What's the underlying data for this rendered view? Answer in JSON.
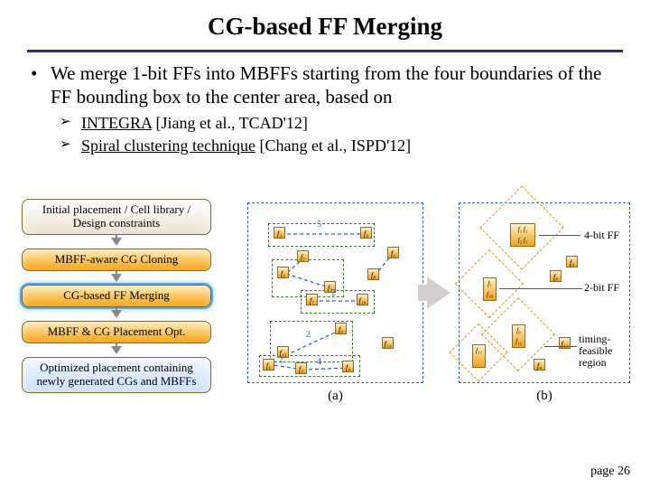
{
  "title": "CG-based FF Merging",
  "main_bullet": "We merge 1-bit FFs into MBFFs starting from the four boundaries of the FF bounding box to the center area, based on",
  "sub_bullets": [
    {
      "leadin": "INTEGRA",
      "rest": " [Jiang et al., TCAD'12]"
    },
    {
      "leadin": "Spiral clustering technique",
      "rest": " [Chang et al., ISPD'12]"
    }
  ],
  "flow": {
    "b1": "Initial placement / Cell library / Design constraints",
    "b2": "MBFF-aware CG Cloning",
    "b3": "CG-based FF Merging",
    "b4": "MBFF & CG Placement Opt.",
    "b5": "Optimized placement containing newly generated CGs and MBFFs"
  },
  "panels": {
    "a": "(a)",
    "b": "(b)"
  },
  "ff_labels": {
    "f1": "f₁",
    "f2": "f₂",
    "f3": "f₃",
    "f4": "f₄",
    "f5": "f₅",
    "f6": "f₆",
    "f7": "f₇",
    "f8": "f₈",
    "f9": "f₉",
    "f10": "f₁₀",
    "f11": "f₁₁",
    "f12": "f₁₂"
  },
  "edge_weights": {
    "e1": "5",
    "e2": "2",
    "e3": "2",
    "e4": "2",
    "e5": "4"
  },
  "legend": {
    "bit4": "4-bit FF",
    "bit2": "2-bit FF",
    "region": "timing-feasible region"
  },
  "page": "page 26",
  "chart_data": {
    "type": "diagram",
    "flow_steps": [
      "Initial placement / Cell library / Design constraints",
      "MBFF-aware CG Cloning",
      "CG-based FF Merging",
      "MBFF & CG Placement Opt.",
      "Optimized placement containing newly generated CGs and MBFFs"
    ],
    "highlighted_step_index": 2,
    "panel_a": {
      "nodes": [
        "f1",
        "f2",
        "f3",
        "f4",
        "f5",
        "f6",
        "f7",
        "f8",
        "f9",
        "f10",
        "f11",
        "f12"
      ],
      "edges": [
        {
          "u": "f2",
          "v": "f5",
          "w": 5
        },
        {
          "u": "f7",
          "v": "f10",
          "w": 2
        },
        {
          "u": "f9",
          "v": "f12",
          "w": 2
        },
        {
          "u": "f1",
          "v": "f3",
          "w": 2
        },
        {
          "u": "f3",
          "v": "f4",
          "w": 4
        }
      ],
      "grouped_pairs": [
        [
          "f2",
          "f5"
        ],
        [
          "f7",
          "f10"
        ],
        [
          "f9",
          "f12"
        ],
        [
          "f1",
          "f3"
        ],
        [
          "f3",
          "f4"
        ]
      ]
    },
    "panel_b": {
      "mbffs": [
        {
          "bits": 4,
          "from": [
            "f1",
            "f3",
            "f2",
            "f5"
          ]
        },
        {
          "bits": 2,
          "from": [
            "f7",
            "f10"
          ]
        },
        {
          "bits": 2,
          "from": [
            "f9",
            "f12"
          ]
        },
        {
          "bits": 2,
          "from": [
            "f11"
          ]
        }
      ],
      "legend": [
        "4-bit FF",
        "2-bit FF",
        "timing-feasible region"
      ]
    }
  }
}
